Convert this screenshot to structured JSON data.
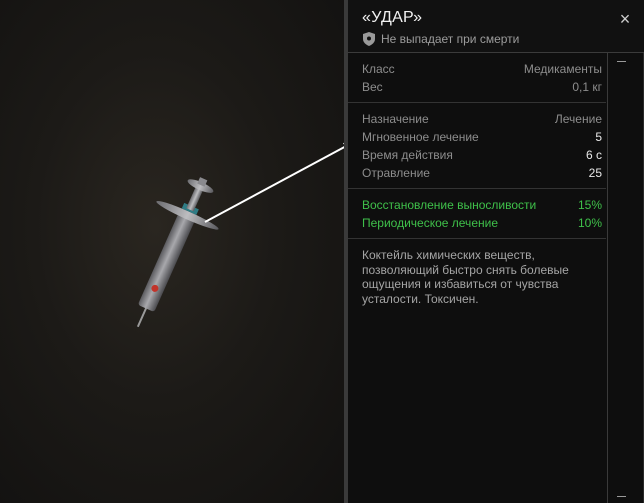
{
  "item": {
    "title": "«УДАР»",
    "subtitle": "Не выпадает при смерти",
    "close_icon": "×"
  },
  "info": [
    {
      "label": "Класс",
      "value": "Медикаменты"
    },
    {
      "label": "Вес",
      "value": "0,1 кг"
    }
  ],
  "stats": [
    {
      "label": "Назначение",
      "value": "Лечение"
    },
    {
      "label": "Мгновенное лечение",
      "value": "5"
    },
    {
      "label": "Время действия",
      "value": "6 с"
    },
    {
      "label": "Отравление",
      "value": "25"
    }
  ],
  "bonuses": [
    {
      "label": "Восстановление выносливости",
      "value": "15%"
    },
    {
      "label": "Периодическое лечение",
      "value": "10%"
    }
  ],
  "description": "Коктейль химических веществ, позволяющий быстро снять болевые ощущения и избавиться от чувства усталости. Токсичен.",
  "colors": {
    "accent_green": "#3fc04a",
    "panel_bg": "#0e0e0e"
  }
}
